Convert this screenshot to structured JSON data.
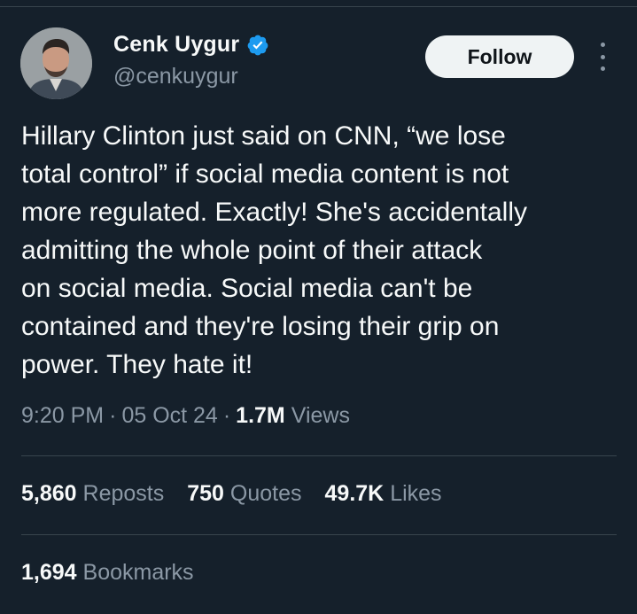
{
  "author": {
    "display_name": "Cenk Uygur",
    "handle": "@cenkuygur",
    "verified_icon": "verified-badge-icon",
    "verified_color": "#1d9bf0"
  },
  "actions": {
    "follow_label": "Follow",
    "more_icon": "more-vertical-icon"
  },
  "tweet": {
    "text": "Hillary Clinton just said on CNN, “we lose\ntotal control” if social media content is not\nmore regulated. Exactly! She's accidentally\nadmitting the whole point of their attack\non social media. Social media can't be\ncontained and they're losing their grip on\npower. They hate it!",
    "time": "9:20 PM",
    "separator": "·",
    "date": "05 Oct 24",
    "views_count": "1.7M",
    "views_label": "Views"
  },
  "stats": {
    "reposts_count": "5,860",
    "reposts_label": "Reposts",
    "quotes_count": "750",
    "quotes_label": "Quotes",
    "likes_count": "49.7K",
    "likes_label": "Likes",
    "bookmarks_count": "1,694",
    "bookmarks_label": "Bookmarks"
  },
  "colors": {
    "background": "#15202b",
    "text_primary": "#f7f9f9",
    "text_secondary": "#8b98a5",
    "divider": "#38444d"
  }
}
